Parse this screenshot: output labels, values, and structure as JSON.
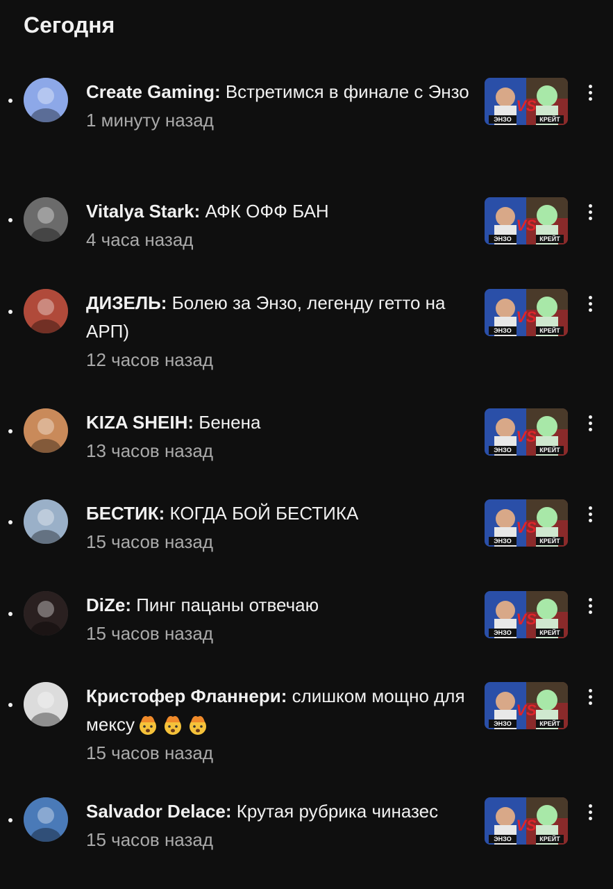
{
  "section_title": "Сегодня",
  "notifications": [
    {
      "author": "Create Gaming:",
      "text": " Встретимся в финале с Энзо",
      "time": "1 минуту назад",
      "avatar_color": "#8da8e8"
    },
    {
      "author": "Vitalya Stark:",
      "text": " АФК ОФФ БАН",
      "time": "4 часа назад",
      "avatar_color": "#6b6b6b"
    },
    {
      "author": "ДИЗЕЛЬ:",
      "text": " Болею за Энзо, легенду гетто на АРП)",
      "time": "12 часов назад",
      "avatar_color": "#b04a3a"
    },
    {
      "author": "KIZA SHEIH:",
      "text": " Бенена",
      "time": "13 часов назад",
      "avatar_color": "#c98a5a"
    },
    {
      "author": "БЕСТИК:",
      "text": " КОГДА  БОЙ БЕСТИКА",
      "time": "15 часов назад",
      "avatar_color": "#9ab0c8"
    },
    {
      "author": "DiZe:",
      "text": " Пинг пацаны отвечаю",
      "time": "15 часов назад",
      "avatar_color": "#2a2020"
    },
    {
      "author": "Кристофер Фланнери:",
      "text": " слишком мощно для мексу",
      "time": "15 часов назад",
      "avatar_color": "#dcdcdc",
      "emojis": [
        "exploding-head",
        "exploding-head",
        "exploding-head"
      ]
    },
    {
      "author": "Salvador Delace:",
      "text": " Крутая рубрика чиназес",
      "time": "15 часов назад",
      "avatar_color": "#4a7ab8"
    }
  ],
  "thumbnail": {
    "left_label": "ЭНЗО",
    "vs_label": "VS",
    "right_label": "КРЕЙТ"
  },
  "colors": {
    "background": "#0f0f0f",
    "text": "#f1f1f1",
    "secondary_text": "#aaaaaa",
    "vs_red": "#e0242a"
  }
}
